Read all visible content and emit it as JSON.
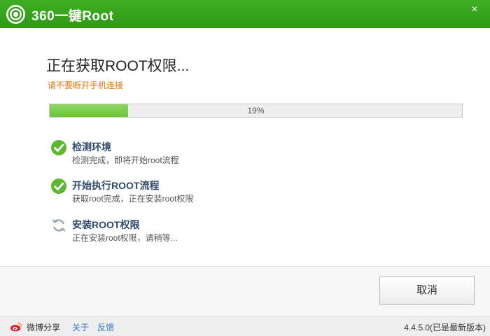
{
  "titlebar": {
    "title": "360一键Root",
    "close_label": "×",
    "bg_color": "#35a31a"
  },
  "main": {
    "title": "正在获取ROOT权限...",
    "subtitle": "请不要断开手机连接",
    "progress": {
      "percent": 19,
      "label": "19%"
    }
  },
  "steps": [
    {
      "title": "检测环境",
      "desc": "检测完成，即将开始root流程",
      "status": "done",
      "icon": "check-circle-icon"
    },
    {
      "title": "开始执行ROOT流程",
      "desc": "获取root完成，正在安装root权限",
      "status": "done",
      "icon": "check-circle-icon"
    },
    {
      "title": "安装ROOT权限",
      "desc": "正在安装root权限，请稍等...",
      "status": "in-progress",
      "icon": "refresh-icon"
    }
  ],
  "footer": {
    "cancel_label": "取消"
  },
  "statusbar": {
    "weibo_share": "微博分享",
    "about": "关于",
    "feedback": "反馈",
    "version": "4.4.5.0(已是最新版本)"
  },
  "colors": {
    "accent_green": "#6cc53e",
    "warning_orange": "#e07a12",
    "link_blue": "#2f77c9"
  }
}
